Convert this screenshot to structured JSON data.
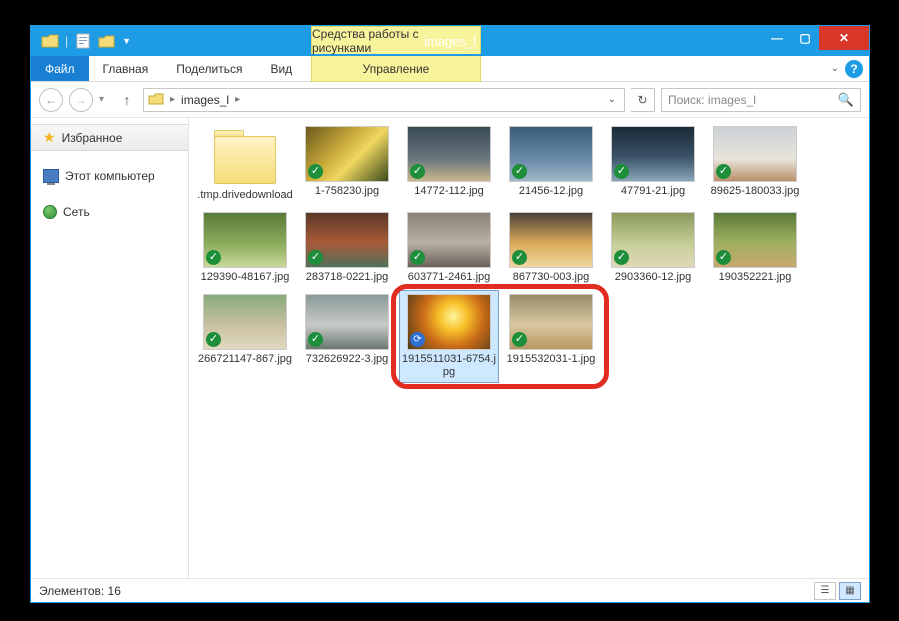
{
  "window": {
    "title": "images_l",
    "contextual_tab_group": "Средства работы с рисунками",
    "contextual_tab": "Управление"
  },
  "ribbon": {
    "file": "Файл",
    "home": "Главная",
    "share": "Поделиться",
    "view": "Вид"
  },
  "nav": {
    "breadcrumb": "images_l",
    "search_placeholder": "Поиск: images_l"
  },
  "sidebar": {
    "favorites": "Избранное",
    "this_pc": "Этот компьютер",
    "network": "Сеть"
  },
  "items": [
    {
      "name": ".tmp.drivedownload",
      "type": "folder",
      "thumb": "folder",
      "overlay": null,
      "selected": false
    },
    {
      "name": "1-758230.jpg",
      "type": "image",
      "thumb": "t-warm",
      "overlay": "check",
      "selected": false
    },
    {
      "name": "14772-112.jpg",
      "type": "image",
      "thumb": "t-dog1",
      "overlay": "check",
      "selected": false
    },
    {
      "name": "21456-12.jpg",
      "type": "image",
      "thumb": "t-blue",
      "overlay": "check",
      "selected": false
    },
    {
      "name": "47791-21.jpg",
      "type": "image",
      "thumb": "t-forest",
      "overlay": "check",
      "selected": false
    },
    {
      "name": "89625-180033.jpg",
      "type": "image",
      "thumb": "t-dog2",
      "overlay": "check",
      "selected": false
    },
    {
      "name": "129390-48167.jpg",
      "type": "image",
      "thumb": "t-grn",
      "overlay": "check",
      "selected": false
    },
    {
      "name": "283718-0221.jpg",
      "type": "image",
      "thumb": "t-red",
      "overlay": "check",
      "selected": false
    },
    {
      "name": "603771-2461.jpg",
      "type": "image",
      "thumb": "t-grey",
      "overlay": "check",
      "selected": false
    },
    {
      "name": "867730-003.jpg",
      "type": "image",
      "thumb": "t-gold",
      "overlay": "check",
      "selected": false
    },
    {
      "name": "2903360-12.jpg",
      "type": "image",
      "thumb": "t-bun1",
      "overlay": "check",
      "selected": false
    },
    {
      "name": "190352221.jpg",
      "type": "image",
      "thumb": "t-bun2",
      "overlay": "check",
      "selected": false
    },
    {
      "name": "266721147-867.jpg",
      "type": "image",
      "thumb": "t-ham",
      "overlay": "check",
      "selected": false
    },
    {
      "name": "732626922-3.jpg",
      "type": "image",
      "thumb": "t-dogs",
      "overlay": "check",
      "selected": false
    },
    {
      "name": "1915511031-6754.jpg",
      "type": "image",
      "thumb": "t-sun",
      "overlay": "sync",
      "selected": true
    },
    {
      "name": "1915532031-1.jpg",
      "type": "image",
      "thumb": "t-cat",
      "overlay": "check",
      "selected": false
    }
  ],
  "status": {
    "count_label": "Элементов: 16"
  },
  "annotation": {
    "highlighted_indices": [
      14,
      15
    ]
  }
}
